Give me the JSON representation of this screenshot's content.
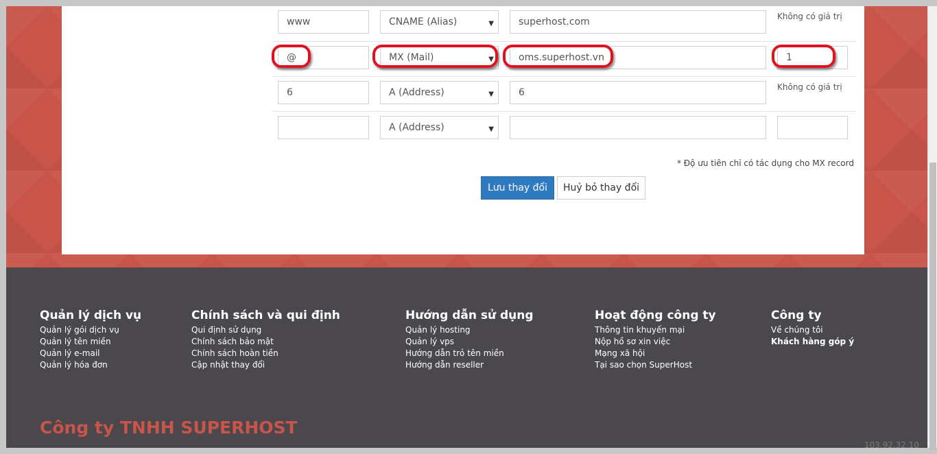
{
  "dns_records": [
    {
      "host": "www",
      "type": "CNAME (Alias)",
      "value": "superhost.com",
      "priority": "",
      "no_value_label": "Không có giá trị"
    },
    {
      "host": "@",
      "type": "MX (Mail)",
      "value": "oms.superhost.vn",
      "priority": "1",
      "no_value_label": ""
    },
    {
      "host": "6",
      "type": "A (Address)",
      "value": "6",
      "priority": "",
      "no_value_label": "Không có giá trị"
    },
    {
      "host": "",
      "type": "A (Address)",
      "value": "",
      "priority": "",
      "no_value_label": ""
    }
  ],
  "form": {
    "note": "* Độ ưu tiên chỉ có tác dụng cho MX record",
    "save_label": "Lưu thay đổi",
    "cancel_label": "Huỷ bỏ thay đổi"
  },
  "footer": {
    "columns": [
      {
        "title": "Quản lý dịch vụ",
        "links": [
          "Quản lý gói dịch vụ",
          "Quản lý tên miền",
          "Quản lý e-mail",
          "Quản lý hóa đơn"
        ]
      },
      {
        "title": "Chính sách và qui định",
        "links": [
          "Qui định sử dụng",
          "Chính sách bảo mật",
          "Chính sách hoàn tiền",
          "Cập nhật thay đổi"
        ]
      },
      {
        "title": "Hướng dẫn sử dụng",
        "links": [
          "Quản lý hosting",
          "Quản lý vps",
          "Hướng dẫn trỏ tên miền",
          "Hướng dẫn reseller"
        ]
      },
      {
        "title": "Hoạt động công ty",
        "links": [
          "Thông tin khuyến mại",
          "Nộp hồ sơ xin việc",
          "Mạng xã hội",
          "Tại sao chọn SuperHost"
        ]
      },
      {
        "title": "Công ty",
        "links": [
          "Về chúng tôi",
          "Khách hàng góp ý"
        ]
      }
    ],
    "company_name": "Công ty TNHH SUPERHOST",
    "stamp": "103.92.32.10"
  },
  "colors": {
    "brand_red": "#c8544a",
    "footer_bg": "#4a484c",
    "primary_button": "#2f7ac0",
    "highlight": "#e0121f"
  }
}
